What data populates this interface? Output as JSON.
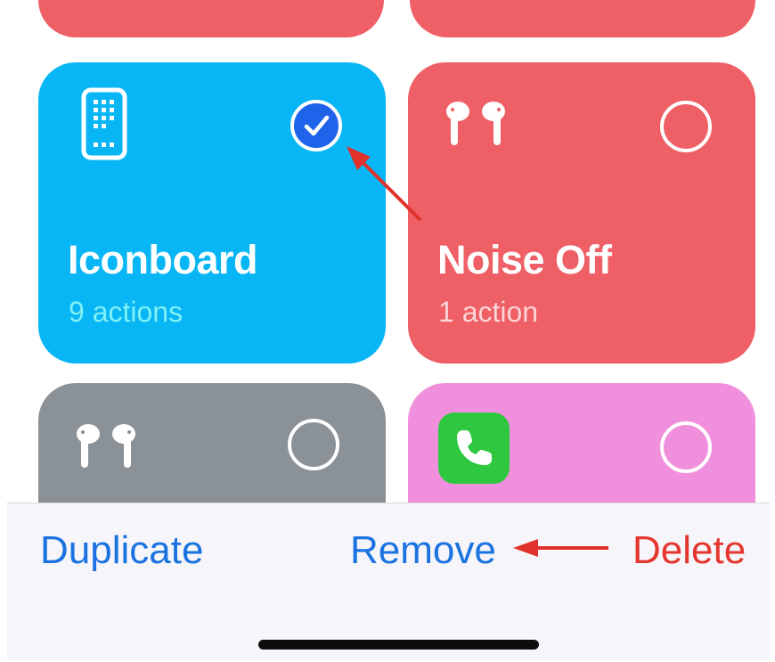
{
  "colors": {
    "tile_blue": "#08b6f5",
    "tile_red": "#ee5f66",
    "tile_gray": "#8a9197",
    "tile_pink": "#f090dc",
    "check_blue": "#1e63e9",
    "action_blue": "#1a73e0",
    "delete_red": "#e5362e",
    "annotation_arrow": "#e0312b"
  },
  "shortcuts": [
    {
      "name": "Iconboard",
      "subtitle": "9 actions",
      "icon": "phone-grid-icon",
      "selected": true
    },
    {
      "name": "Noise Off",
      "subtitle": "1 action",
      "icon": "airpods-icon",
      "selected": false
    },
    {
      "name": "",
      "subtitle": "",
      "icon": "airpods-icon",
      "selected": false
    },
    {
      "name": "",
      "subtitle": "",
      "icon": "phone-app-icon",
      "selected": false
    }
  ],
  "toolbar": {
    "duplicate_label": "Duplicate",
    "remove_label": "Remove",
    "delete_label": "Delete"
  }
}
